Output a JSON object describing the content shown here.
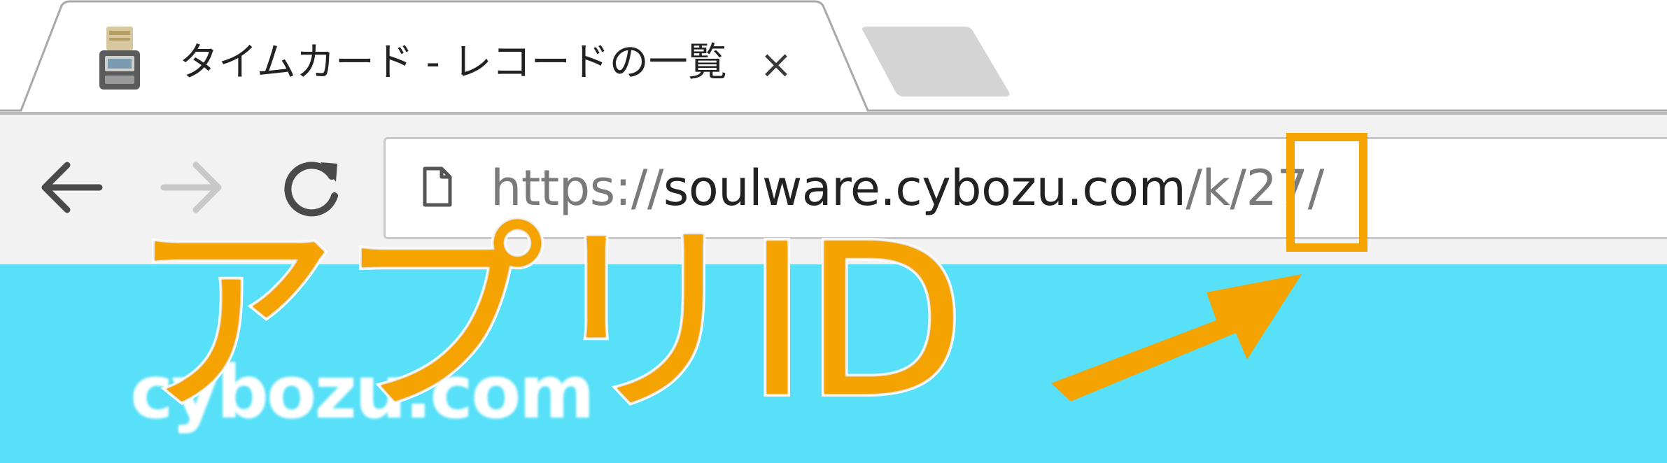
{
  "browser": {
    "tab": {
      "title": "タイムカード - レコードの一覧",
      "close_glyph": "×",
      "favicon": "timecard-icon"
    },
    "new_tab": {
      "icon": "new-tab-button"
    },
    "toolbar": {
      "back_icon": "back-arrow-icon",
      "forward_icon": "forward-arrow-icon",
      "reload_icon": "reload-icon",
      "page_info_icon": "page-icon"
    },
    "address_bar": {
      "scheme": "https://",
      "host": "soulware.cybozu.com",
      "path_prefix": "/k/",
      "app_id": "27",
      "path_suffix": "/"
    }
  },
  "page": {
    "logo_text": "cybozu.com",
    "background_color": "#57e0f8"
  },
  "annotation": {
    "label": "アプリID",
    "color": "#f5a300",
    "outline_color": "#ffffff",
    "arrow_icon": "arrow-up-right-icon"
  }
}
